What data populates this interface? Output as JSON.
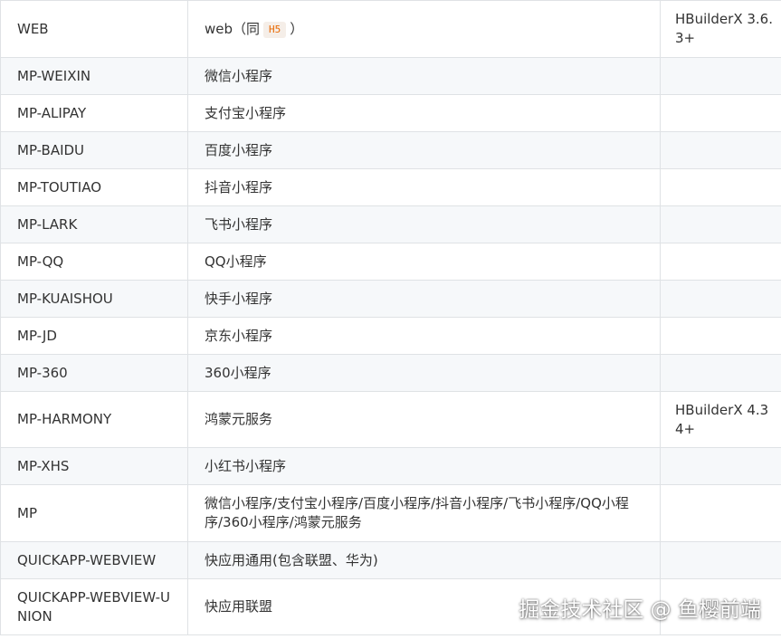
{
  "rows": [
    {
      "platform": "WEB",
      "description_prefix": "web（同",
      "description_code": "H5",
      "description_suffix": "）",
      "version": "HBuilderX 3.6.3+"
    },
    {
      "platform": "MP-WEIXIN",
      "description": "微信小程序",
      "version": ""
    },
    {
      "platform": "MP-ALIPAY",
      "description": "支付宝小程序",
      "version": ""
    },
    {
      "platform": "MP-BAIDU",
      "description": "百度小程序",
      "version": ""
    },
    {
      "platform": "MP-TOUTIAO",
      "description": "抖音小程序",
      "version": ""
    },
    {
      "platform": "MP-LARK",
      "description": "飞书小程序",
      "version": ""
    },
    {
      "platform": "MP-QQ",
      "description": "QQ小程序",
      "version": ""
    },
    {
      "platform": "MP-KUAISHOU",
      "description": "快手小程序",
      "version": ""
    },
    {
      "platform": "MP-JD",
      "description": "京东小程序",
      "version": ""
    },
    {
      "platform": "MP-360",
      "description": "360小程序",
      "version": ""
    },
    {
      "platform": "MP-HARMONY",
      "description": "鸿蒙元服务",
      "version": "HBuilderX 4.34+"
    },
    {
      "platform": "MP-XHS",
      "description": "小红书小程序",
      "version": ""
    },
    {
      "platform": "MP",
      "description": "微信小程序/支付宝小程序/百度小程序/抖音小程序/飞书小程序/QQ小程序/360小程序/鸿蒙元服务",
      "version": ""
    },
    {
      "platform": "QUICKAPP-WEBVIEW",
      "description": "快应用通用(包含联盟、华为)",
      "version": ""
    },
    {
      "platform": "QUICKAPP-WEBVIEW-UNION",
      "description": "快应用联盟",
      "version": ""
    }
  ],
  "watermark": "掘金技术社区 @ 鱼樱前端",
  "colors": {
    "border": "#dfe2e5",
    "stripe": "#f6f8fa",
    "text": "#333333",
    "code_text": "#e96900",
    "code_bg": "#f5eee8"
  }
}
